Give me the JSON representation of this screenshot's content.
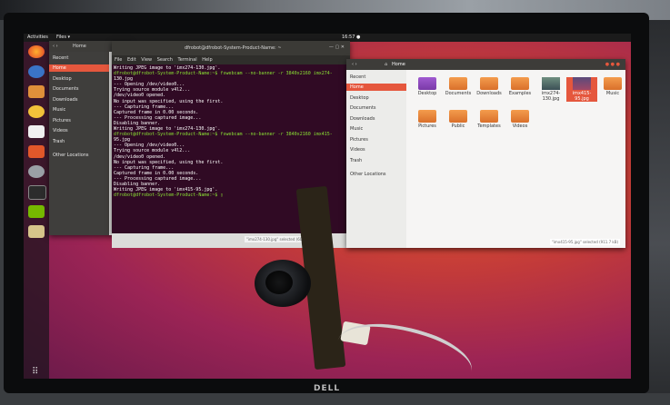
{
  "topbar": {
    "activities": "Activities",
    "files_menu": "Files ▾",
    "clock": "16:57 ●"
  },
  "terminal": {
    "title": "dfrobot@dfrobot-System-Product-Name: ~",
    "menu": [
      "File",
      "Edit",
      "View",
      "Search",
      "Terminal",
      "Help"
    ],
    "lines": [
      {
        "t": "Writing JPEG image to 'imx274-130.jpg'.",
        "p": false
      },
      {
        "t": "dfrobot@dfrobot-System-Product-Name:~$ fswebcam --no-banner -r 3840x2160 imx274-",
        "p": true
      },
      {
        "t": "130.jpg",
        "p": false
      },
      {
        "t": "--- Opening /dev/video0...",
        "p": false
      },
      {
        "t": "Trying source module v4l2...",
        "p": false
      },
      {
        "t": "/dev/video0 opened.",
        "p": false
      },
      {
        "t": "No input was specified, using the first.",
        "p": false
      },
      {
        "t": "--- Capturing frame...",
        "p": false
      },
      {
        "t": "Captured frame in 0.00 seconds.",
        "p": false
      },
      {
        "t": "--- Processing captured image...",
        "p": false
      },
      {
        "t": "Disabling banner.",
        "p": false
      },
      {
        "t": "Writing JPEG image to 'imx274-130.jpg'.",
        "p": false
      },
      {
        "t": "dfrobot@dfrobot-System-Product-Name:~$ fswebcam --no-banner -r 3840x2160 imx415-",
        "p": true
      },
      {
        "t": "95.jpg",
        "p": false
      },
      {
        "t": "--- Opening /dev/video0...",
        "p": false
      },
      {
        "t": "Trying source module v4l2...",
        "p": false
      },
      {
        "t": "/dev/video0 opened.",
        "p": false
      },
      {
        "t": "No input was specified, using the first.",
        "p": false
      },
      {
        "t": "--- Capturing frame...",
        "p": false
      },
      {
        "t": "Captured frame in 0.00 seconds.",
        "p": false
      },
      {
        "t": "--- Processing captured image...",
        "p": false
      },
      {
        "t": "Disabling banner.",
        "p": false
      },
      {
        "t": "Writing JPEG image to 'imx415-95.jpg'.",
        "p": false
      },
      {
        "t": "dfrobot@dfrobot-System-Product-Name:~$ ▯",
        "p": true
      }
    ]
  },
  "files_back": {
    "path": "Home",
    "sidebar": [
      "Recent",
      "Home",
      "Desktop",
      "Documents",
      "Downloads",
      "Music",
      "Pictures",
      "Videos",
      "Trash",
      "Other Locations"
    ],
    "status": "\"imx274-130.jpg\" selected (604.3 kB)"
  },
  "files_front": {
    "path": "Home",
    "sidebar": [
      "Recent",
      "Home",
      "Desktop",
      "Documents",
      "Downloads",
      "Music",
      "Pictures",
      "Videos",
      "Trash",
      "Other Locations"
    ],
    "items": [
      "Desktop",
      "Documents",
      "Downloads",
      "Examples",
      "imx274-130.jpg",
      "imx415-95.jpg",
      "Music",
      "Pictures",
      "Public",
      "Templates",
      "Videos"
    ],
    "status": "\"imx415-95.jpg\" selected (911.7 kB)"
  },
  "monitor_brand": "DELL"
}
